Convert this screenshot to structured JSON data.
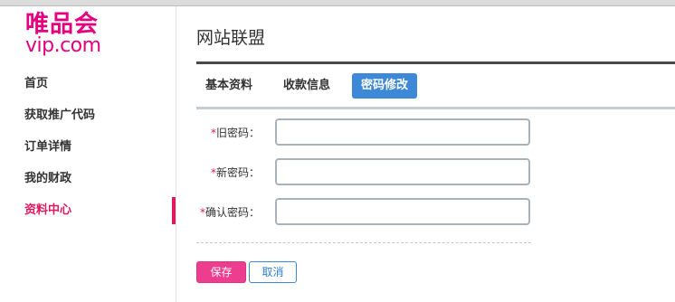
{
  "brand": {
    "name_cn": "唯品会",
    "name_en": "vip.com",
    "color": "#e5007f"
  },
  "sidebar": {
    "items": [
      {
        "label": "首页"
      },
      {
        "label": "获取推广代码"
      },
      {
        "label": "订单详情"
      },
      {
        "label": "我的财政"
      },
      {
        "label": "资料中心",
        "active": true
      }
    ]
  },
  "main": {
    "title": "网站联盟",
    "tabs": [
      {
        "label": "基本资料"
      },
      {
        "label": "收款信息"
      },
      {
        "label": "密码修改",
        "active": true
      }
    ],
    "form": {
      "required_mark": "*",
      "fields": [
        {
          "label": "旧密码：",
          "value": ""
        },
        {
          "label": "新密码：",
          "value": ""
        },
        {
          "label": "确认密码：",
          "value": ""
        }
      ],
      "save_label": "保存",
      "cancel_label": "取消"
    }
  },
  "colors": {
    "accent_pink": "#e0185c",
    "tab_active_blue": "#3d89d8",
    "save_button": "#ec3d8e"
  }
}
